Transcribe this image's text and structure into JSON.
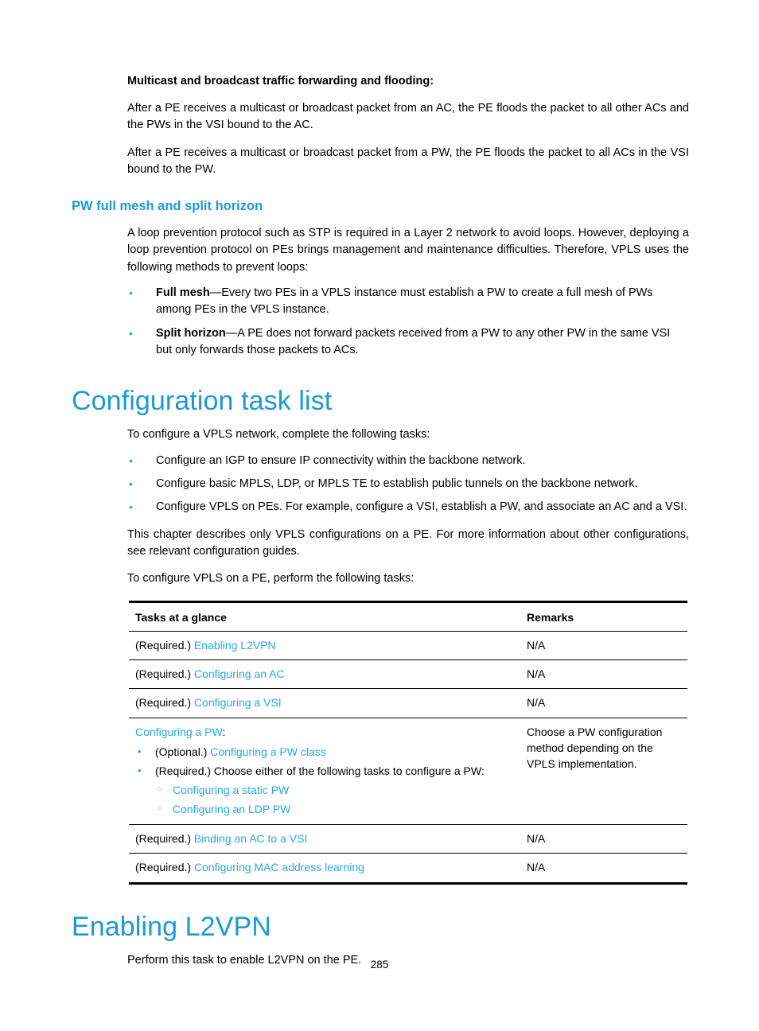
{
  "page": {
    "number": "285"
  },
  "colors": {
    "heading_blue": "#1b9ad6",
    "link_blue": "#29a9e0",
    "bullet_blue": "#2aa3dd",
    "text_black": "#000000"
  },
  "intro": {
    "lead": "Multicast and broadcast traffic forwarding and flooding:",
    "para1": "After a PE receives a multicast or broadcast packet from an AC, the PE floods the packet to all other ACs and the PWs in the VSI bound to the AC.",
    "para2": "After a PE receives a multicast or broadcast packet from a PW, the PE floods the packet to all ACs in the VSI bound to the PW."
  },
  "pw_section": {
    "heading": "PW full mesh and split horizon",
    "para": "A loop prevention protocol such as STP is required in a Layer 2 network to avoid loops. However, deploying a loop prevention protocol on PEs brings management and maintenance difficulties. Therefore, VPLS uses the following methods to prevent loops:",
    "bullets": [
      {
        "term": "Full mesh",
        "rest": "—Every two PEs in a VPLS instance must establish a PW to create a full mesh of PWs among PEs in the VPLS instance."
      },
      {
        "term": "Split horizon",
        "rest": "—A PE does not forward packets received from a PW to any other PW in the same VSI but only forwards those packets to ACs."
      }
    ]
  },
  "config_task_list": {
    "heading": "Configuration task list",
    "intro": "To configure a VPLS network, complete the following tasks:",
    "bullets": [
      "Configure an IGP to ensure IP connectivity within the backbone network.",
      "Configure basic MPLS, LDP, or MPLS TE to establish public tunnels on the backbone network.",
      "Configure VPLS on PEs. For example, configure a VSI, establish a PW, and associate an AC and a VSI."
    ],
    "note": "This chapter describes only VPLS configurations on a PE. For more information about other configurations, see relevant configuration guides.",
    "table_intro": "To configure VPLS on a PE, perform the following tasks:"
  },
  "table": {
    "headers": {
      "col1": "Tasks at a glance",
      "col2": "Remarks"
    },
    "rows": [
      {
        "prefix": "(Required.) ",
        "link": "Enabling L2VPN",
        "remarks": "N/A"
      },
      {
        "prefix": "(Required.) ",
        "link": "Configuring an AC",
        "remarks": "N/A"
      },
      {
        "prefix": "(Required.) ",
        "link": "Configuring a VSI",
        "remarks": "N/A"
      }
    ],
    "pw_row": {
      "title_link": "Configuring a PW",
      "title_suffix": ":",
      "bullets": [
        {
          "prefix": "(Optional.) ",
          "link": "Configuring a PW class",
          "suffix": ""
        },
        {
          "prefix": "(Required.) Choose either of the following tasks to configure a PW:",
          "link": "",
          "suffix": ""
        }
      ],
      "sub_bullets": [
        "Configuring a static PW",
        "Configuring an LDP PW"
      ],
      "remarks": "Choose a PW configuration method depending on the VPLS implementation."
    },
    "tail_rows": [
      {
        "prefix": "(Required.) ",
        "link": "Binding an AC to a VSI",
        "remarks": "N/A"
      },
      {
        "prefix": "(Required.) ",
        "link": "Configuring MAC address learning",
        "remarks": "N/A"
      }
    ]
  },
  "enabling_l2vpn": {
    "heading": "Enabling L2VPN",
    "para": "Perform this task to enable L2VPN on the PE."
  },
  "icons": {
    "bullet": "•",
    "hollow_circle": "○"
  }
}
